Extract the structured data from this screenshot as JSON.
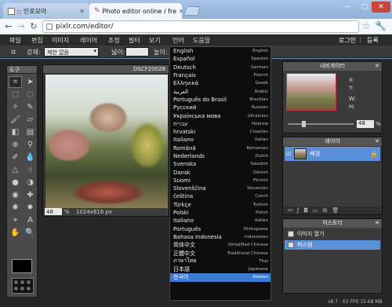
{
  "browser": {
    "tabs": [
      {
        "title": ":: 인포모아",
        "active": false
      },
      {
        "title": "Photo editor online / fre",
        "active": true
      }
    ],
    "url": "pixlr.com/editor/"
  },
  "app_menu": {
    "items": [
      "파일",
      "편집",
      "이미지",
      "레이어",
      "조정",
      "필터",
      "보기",
      "언어",
      "도움말"
    ],
    "login": "로그인",
    "separator": "|",
    "signup": "등록"
  },
  "options_bar": {
    "constraint_label": "강제:",
    "constraint_value": "제한 없음",
    "width_label": "넓이:",
    "height_label": "높이:"
  },
  "tools_panel": {
    "title": "도구"
  },
  "image_window": {
    "title": "DSCF20028",
    "zoom": "48",
    "zoom_unit": "%",
    "dimensions": "1024x616 px"
  },
  "language_menu": {
    "items": [
      {
        "native": "English",
        "english": "English"
      },
      {
        "native": "Español",
        "english": "Spanish"
      },
      {
        "native": "Deutsch",
        "english": "German"
      },
      {
        "native": "Français",
        "english": "French"
      },
      {
        "native": "Ελληνικά",
        "english": "Greek"
      },
      {
        "native": "العربية",
        "english": "Arabic"
      },
      {
        "native": "Português do Brasil",
        "english": "Brazilian"
      },
      {
        "native": "Русский",
        "english": "Russian"
      },
      {
        "native": "Українська мова",
        "english": "Ukrainian"
      },
      {
        "native": "עברית",
        "english": "Hebrew"
      },
      {
        "native": "hrvatski",
        "english": "Croatian"
      },
      {
        "native": "Italiano",
        "english": "Italian"
      },
      {
        "native": "Română",
        "english": "Romanian"
      },
      {
        "native": "Nederlands",
        "english": "Dutch"
      },
      {
        "native": "Svenska",
        "english": "Swedish"
      },
      {
        "native": "Dansk",
        "english": "Danish"
      },
      {
        "native": "Suomi",
        "english": "Finnish"
      },
      {
        "native": "Slovenščina",
        "english": "Slovenian"
      },
      {
        "native": "čeština",
        "english": "Czech"
      },
      {
        "native": "Türkçe",
        "english": "Turkish"
      },
      {
        "native": "Polski",
        "english": "Polish"
      },
      {
        "native": "Italiano",
        "english": "Italian"
      },
      {
        "native": "Português",
        "english": "Portuguese"
      },
      {
        "native": "Bahasa Indonesia",
        "english": "Indonesian"
      },
      {
        "native": "简体中文",
        "english": "Simplified Chinese"
      },
      {
        "native": "正體中文",
        "english": "Traditional Chinese"
      },
      {
        "native": "ภาษาไทย",
        "english": "Thai"
      },
      {
        "native": "日本語",
        "english": "Japanese"
      },
      {
        "native": "한국어",
        "english": "Korean",
        "selected": true
      }
    ]
  },
  "navigator": {
    "title": "내비게이터",
    "x_label": "X:",
    "y_label": "Y:",
    "w_label": "W:",
    "h_label": "H:",
    "zoom": "48",
    "zoom_unit": "%"
  },
  "layers": {
    "title": "레이어",
    "items": [
      {
        "name": "배경"
      }
    ]
  },
  "history": {
    "title": "히스토리",
    "items": [
      {
        "name": "이미지 열기"
      },
      {
        "name": "퍼스템"
      }
    ]
  },
  "status": {
    "fps": "v8.7 : 63 FPS 15.68 MB"
  },
  "colors": {
    "accent": "#5b8fd8",
    "selected_language": "#3b7bd4",
    "app_background": "#262626"
  }
}
